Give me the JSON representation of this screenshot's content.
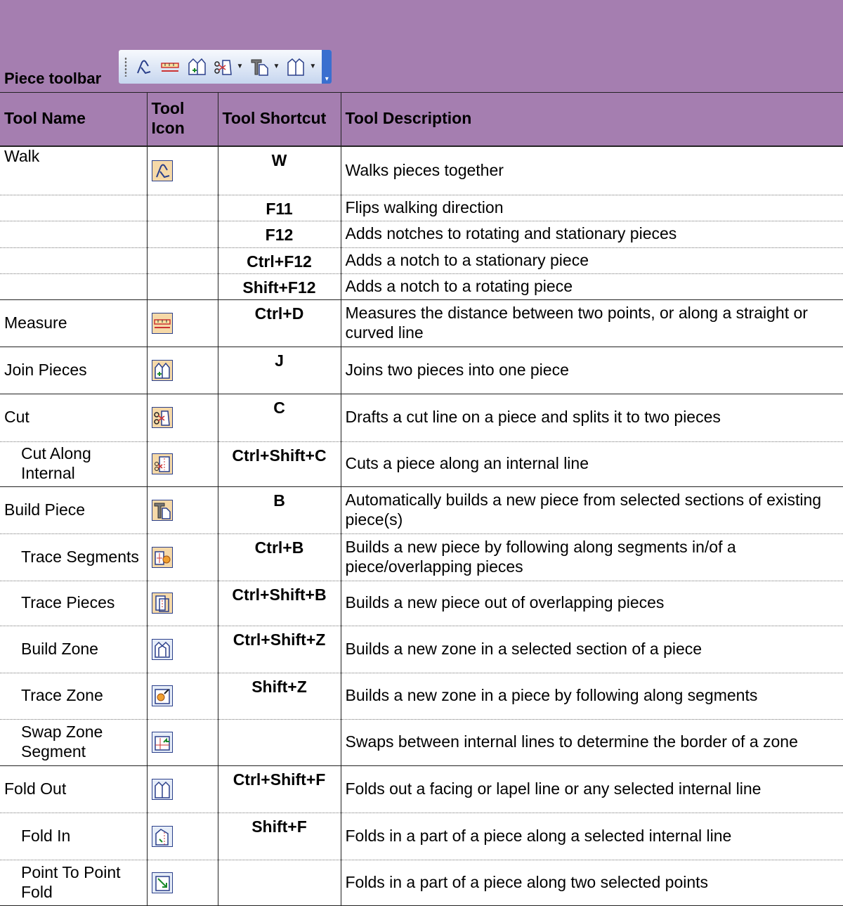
{
  "toolbar": {
    "title": "Piece toolbar",
    "icons": [
      "walk-icon",
      "measure-icon",
      "join-pieces-icon",
      "cut-icon",
      "build-piece-icon",
      "fold-out-icon",
      "toolbar-options-icon"
    ]
  },
  "table": {
    "headers": [
      "Tool Name",
      "Tool Icon",
      "Tool Shortcut",
      "Tool Description"
    ],
    "rows": [
      {
        "name": "Walk",
        "sub": false,
        "icon": "walk-icon",
        "shortcut": "W",
        "description": "Walks pieces together"
      },
      {
        "name": "",
        "sub": false,
        "icon": "",
        "shortcut": "F11",
        "description": "Flips walking direction"
      },
      {
        "name": "",
        "sub": false,
        "icon": "",
        "shortcut": "F12",
        "description": "Adds notches to rotating and stationary pieces"
      },
      {
        "name": "",
        "sub": false,
        "icon": "",
        "shortcut": "Ctrl+F12",
        "description": "Adds a notch to a stationary piece"
      },
      {
        "name": "",
        "sub": false,
        "icon": "",
        "shortcut": "Shift+F12",
        "description": "Adds a notch to a rotating piece"
      },
      {
        "name": "Measure",
        "sub": false,
        "icon": "measure-icon",
        "shortcut": "Ctrl+D",
        "description": "Measures the distance between two points, or along a straight or curved line"
      },
      {
        "name": "Join Pieces",
        "sub": false,
        "icon": "join-pieces-icon",
        "shortcut": "J",
        "description": "Joins two pieces into one piece"
      },
      {
        "name": "Cut",
        "sub": false,
        "icon": "cut-icon",
        "shortcut": "C",
        "description": "Drafts a cut line on a piece and splits it to two pieces"
      },
      {
        "name": "Cut Along Internal",
        "sub": true,
        "icon": "cut-along-internal-icon",
        "shortcut": "Ctrl+Shift+C",
        "description": "Cuts a piece along an internal line"
      },
      {
        "name": "Build Piece",
        "sub": false,
        "icon": "build-piece-icon",
        "shortcut": "B",
        "description": "Automatically builds a new piece from selected sections of existing piece(s)"
      },
      {
        "name": "Trace Segments",
        "sub": true,
        "icon": "trace-segments-icon",
        "shortcut": "Ctrl+B",
        "description": "Builds a new piece by following along segments in/of a piece/overlapping pieces"
      },
      {
        "name": "Trace Pieces",
        "sub": true,
        "icon": "trace-pieces-icon",
        "shortcut": "Ctrl+Shift+B",
        "description": "Builds a new piece out of overlapping pieces"
      },
      {
        "name": "Build Zone",
        "sub": true,
        "icon": "build-zone-icon",
        "shortcut": "Ctrl+Shift+Z",
        "description": "Builds a new zone in a selected section of a piece"
      },
      {
        "name": "Trace Zone",
        "sub": true,
        "icon": "trace-zone-icon",
        "shortcut": "Shift+Z",
        "description": "Builds a new zone in a piece by following along segments"
      },
      {
        "name": "Swap Zone Segment",
        "sub": true,
        "icon": "swap-zone-segment-icon",
        "shortcut": "",
        "description": "Swaps between internal lines to determine the border of a zone"
      },
      {
        "name": "Fold Out",
        "sub": false,
        "icon": "fold-out-icon",
        "shortcut": "Ctrl+Shift+F",
        "description": "Folds out a facing or lapel line or any selected internal line"
      },
      {
        "name": "Fold In",
        "sub": true,
        "icon": "fold-in-icon",
        "shortcut": "Shift+F",
        "description": "Folds in a part of a piece along a selected internal line"
      },
      {
        "name": "Point To Point Fold",
        "sub": true,
        "icon": "point-to-point-fold-icon",
        "shortcut": "",
        "description": "Folds in a part of a piece along two selected points"
      }
    ]
  }
}
